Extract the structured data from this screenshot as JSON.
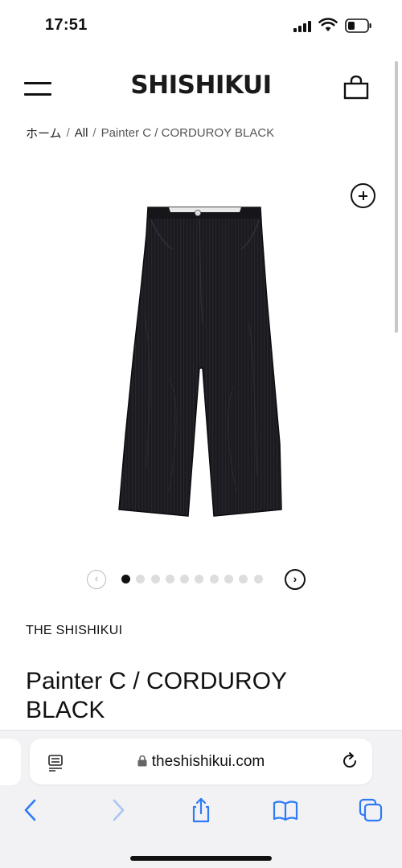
{
  "status_bar": {
    "time": "17:51"
  },
  "header": {
    "brand": "SHISHIKUI",
    "menu_icon": "hamburger-menu-icon",
    "cart_icon": "shopping-bag-icon"
  },
  "breadcrumb": {
    "items": [
      "ホーム",
      "All"
    ],
    "separator": "/",
    "current": "Painter C / CORDUROY BLACK"
  },
  "gallery": {
    "zoom_icon": "zoom-plus-icon",
    "image_subject": "black corduroy trousers",
    "total_images": 10,
    "active_index": 0,
    "prev_label": "‹",
    "next_label": "›"
  },
  "product": {
    "vendor": "THE SHISHIKUI",
    "title": "Painter C / CORDUROY BLACK"
  },
  "browser": {
    "url": "theshishikui.com",
    "reader_icon": "reader-mode-icon",
    "lock_icon": "lock-icon",
    "reload_icon": "reload-icon",
    "toolbar": [
      "back-icon",
      "forward-icon",
      "share-icon",
      "bookmarks-icon",
      "tabs-icon"
    ]
  },
  "colors": {
    "text": "#111111",
    "chrome_bg": "#f2f2f4",
    "dot_inactive": "#dddddd",
    "dot_active": "#111111",
    "toolbar_active": "#2f7bf6",
    "toolbar_disabled": "#a9c6f6"
  }
}
